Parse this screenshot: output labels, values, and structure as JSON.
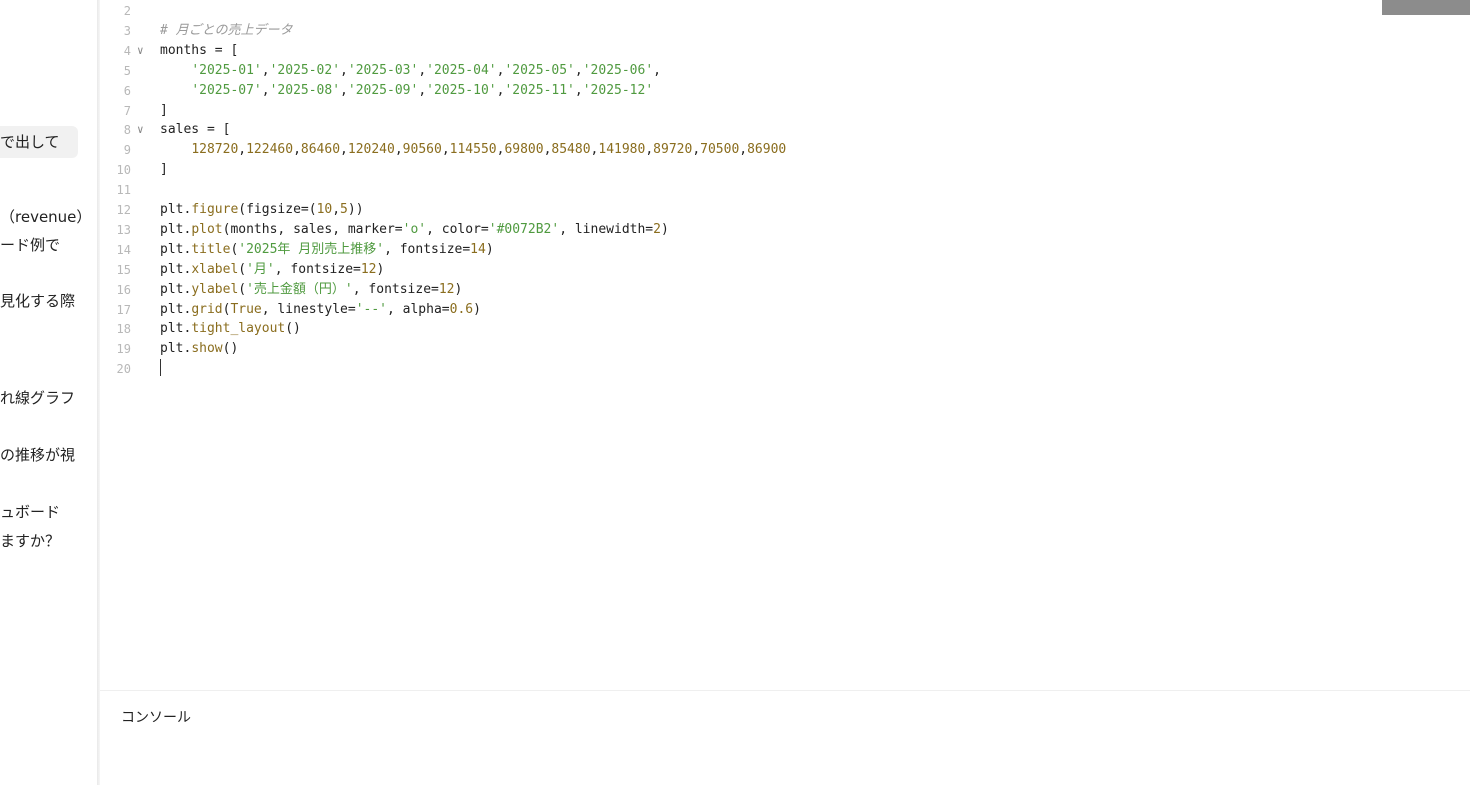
{
  "chat": {
    "lines": [
      "で出して",
      "（revenue）",
      "ード例で",
      "見化する際",
      "れ線グラフ",
      "の推移が視",
      "ュボード",
      "ますか？"
    ]
  },
  "editor": {
    "lines": [
      {
        "num": "2",
        "fold": "",
        "tokens": []
      },
      {
        "num": "3",
        "fold": "",
        "tokens": [
          {
            "t": "cm",
            "v": "# 月ごとの売上データ"
          }
        ]
      },
      {
        "num": "4",
        "fold": "v",
        "tokens": [
          {
            "t": "kw",
            "v": "months = ["
          }
        ]
      },
      {
        "num": "5",
        "fold": "",
        "tokens": [
          {
            "t": "kw",
            "v": "    "
          },
          {
            "t": "str",
            "v": "'2025-01'"
          },
          {
            "t": "kw",
            "v": ","
          },
          {
            "t": "str",
            "v": "'2025-02'"
          },
          {
            "t": "kw",
            "v": ","
          },
          {
            "t": "str",
            "v": "'2025-03'"
          },
          {
            "t": "kw",
            "v": ","
          },
          {
            "t": "str",
            "v": "'2025-04'"
          },
          {
            "t": "kw",
            "v": ","
          },
          {
            "t": "str",
            "v": "'2025-05'"
          },
          {
            "t": "kw",
            "v": ","
          },
          {
            "t": "str",
            "v": "'2025-06'"
          },
          {
            "t": "kw",
            "v": ","
          }
        ]
      },
      {
        "num": "6",
        "fold": "",
        "tokens": [
          {
            "t": "kw",
            "v": "    "
          },
          {
            "t": "str",
            "v": "'2025-07'"
          },
          {
            "t": "kw",
            "v": ","
          },
          {
            "t": "str",
            "v": "'2025-08'"
          },
          {
            "t": "kw",
            "v": ","
          },
          {
            "t": "str",
            "v": "'2025-09'"
          },
          {
            "t": "kw",
            "v": ","
          },
          {
            "t": "str",
            "v": "'2025-10'"
          },
          {
            "t": "kw",
            "v": ","
          },
          {
            "t": "str",
            "v": "'2025-11'"
          },
          {
            "t": "kw",
            "v": ","
          },
          {
            "t": "str",
            "v": "'2025-12'"
          }
        ]
      },
      {
        "num": "7",
        "fold": "",
        "tokens": [
          {
            "t": "kw",
            "v": "]"
          }
        ]
      },
      {
        "num": "8",
        "fold": "v",
        "tokens": [
          {
            "t": "kw",
            "v": "sales = ["
          }
        ]
      },
      {
        "num": "9",
        "fold": "",
        "tokens": [
          {
            "t": "kw",
            "v": "    "
          },
          {
            "t": "num",
            "v": "128720"
          },
          {
            "t": "kw",
            "v": ","
          },
          {
            "t": "num",
            "v": "122460"
          },
          {
            "t": "kw",
            "v": ","
          },
          {
            "t": "num",
            "v": "86460"
          },
          {
            "t": "kw",
            "v": ","
          },
          {
            "t": "num",
            "v": "120240"
          },
          {
            "t": "kw",
            "v": ","
          },
          {
            "t": "num",
            "v": "90560"
          },
          {
            "t": "kw",
            "v": ","
          },
          {
            "t": "num",
            "v": "114550"
          },
          {
            "t": "kw",
            "v": ","
          },
          {
            "t": "num",
            "v": "69800"
          },
          {
            "t": "kw",
            "v": ","
          },
          {
            "t": "num",
            "v": "85480"
          },
          {
            "t": "kw",
            "v": ","
          },
          {
            "t": "num",
            "v": "141980"
          },
          {
            "t": "kw",
            "v": ","
          },
          {
            "t": "num",
            "v": "89720"
          },
          {
            "t": "kw",
            "v": ","
          },
          {
            "t": "num",
            "v": "70500"
          },
          {
            "t": "kw",
            "v": ","
          },
          {
            "t": "num",
            "v": "86900"
          }
        ]
      },
      {
        "num": "10",
        "fold": "",
        "tokens": [
          {
            "t": "kw",
            "v": "]"
          }
        ]
      },
      {
        "num": "11",
        "fold": "",
        "tokens": []
      },
      {
        "num": "12",
        "fold": "",
        "tokens": [
          {
            "t": "kw",
            "v": "plt."
          },
          {
            "t": "fn",
            "v": "figure"
          },
          {
            "t": "kw",
            "v": "(figsize=("
          },
          {
            "t": "num",
            "v": "10"
          },
          {
            "t": "kw",
            "v": ","
          },
          {
            "t": "num",
            "v": "5"
          },
          {
            "t": "kw",
            "v": "))"
          }
        ]
      },
      {
        "num": "13",
        "fold": "",
        "tokens": [
          {
            "t": "kw",
            "v": "plt."
          },
          {
            "t": "fn",
            "v": "plot"
          },
          {
            "t": "kw",
            "v": "(months, sales, marker="
          },
          {
            "t": "str",
            "v": "'o'"
          },
          {
            "t": "kw",
            "v": ", color="
          },
          {
            "t": "str",
            "v": "'#0072B2'"
          },
          {
            "t": "kw",
            "v": ", linewidth="
          },
          {
            "t": "num",
            "v": "2"
          },
          {
            "t": "kw",
            "v": ")"
          }
        ]
      },
      {
        "num": "14",
        "fold": "",
        "tokens": [
          {
            "t": "kw",
            "v": "plt."
          },
          {
            "t": "fn",
            "v": "title"
          },
          {
            "t": "kw",
            "v": "("
          },
          {
            "t": "str",
            "v": "'2025年 月別売上推移'"
          },
          {
            "t": "kw",
            "v": ", fontsize="
          },
          {
            "t": "num",
            "v": "14"
          },
          {
            "t": "kw",
            "v": ")"
          }
        ]
      },
      {
        "num": "15",
        "fold": "",
        "tokens": [
          {
            "t": "kw",
            "v": "plt."
          },
          {
            "t": "fn",
            "v": "xlabel"
          },
          {
            "t": "kw",
            "v": "("
          },
          {
            "t": "str",
            "v": "'月'"
          },
          {
            "t": "kw",
            "v": ", fontsize="
          },
          {
            "t": "num",
            "v": "12"
          },
          {
            "t": "kw",
            "v": ")"
          }
        ]
      },
      {
        "num": "16",
        "fold": "",
        "tokens": [
          {
            "t": "kw",
            "v": "plt."
          },
          {
            "t": "fn",
            "v": "ylabel"
          },
          {
            "t": "kw",
            "v": "("
          },
          {
            "t": "str",
            "v": "'売上金額（円）'"
          },
          {
            "t": "kw",
            "v": ", fontsize="
          },
          {
            "t": "num",
            "v": "12"
          },
          {
            "t": "kw",
            "v": ")"
          }
        ]
      },
      {
        "num": "17",
        "fold": "",
        "tokens": [
          {
            "t": "kw",
            "v": "plt."
          },
          {
            "t": "fn",
            "v": "grid"
          },
          {
            "t": "kw",
            "v": "("
          },
          {
            "t": "fn",
            "v": "True"
          },
          {
            "t": "kw",
            "v": ", linestyle="
          },
          {
            "t": "str",
            "v": "'--'"
          },
          {
            "t": "kw",
            "v": ", alpha="
          },
          {
            "t": "num",
            "v": "0.6"
          },
          {
            "t": "kw",
            "v": ")"
          }
        ]
      },
      {
        "num": "18",
        "fold": "",
        "tokens": [
          {
            "t": "kw",
            "v": "plt."
          },
          {
            "t": "fn",
            "v": "tight_layout"
          },
          {
            "t": "kw",
            "v": "()"
          }
        ]
      },
      {
        "num": "19",
        "fold": "",
        "tokens": [
          {
            "t": "kw",
            "v": "plt."
          },
          {
            "t": "fn",
            "v": "show"
          },
          {
            "t": "kw",
            "v": "()"
          }
        ]
      },
      {
        "num": "20",
        "fold": "",
        "tokens": []
      }
    ]
  },
  "console": {
    "title": "コンソール"
  },
  "colors": {
    "string": "#4f9a3f",
    "number": "#8a6d1e",
    "comment": "#9a9a9a",
    "line_number": "#b8b8b8"
  }
}
